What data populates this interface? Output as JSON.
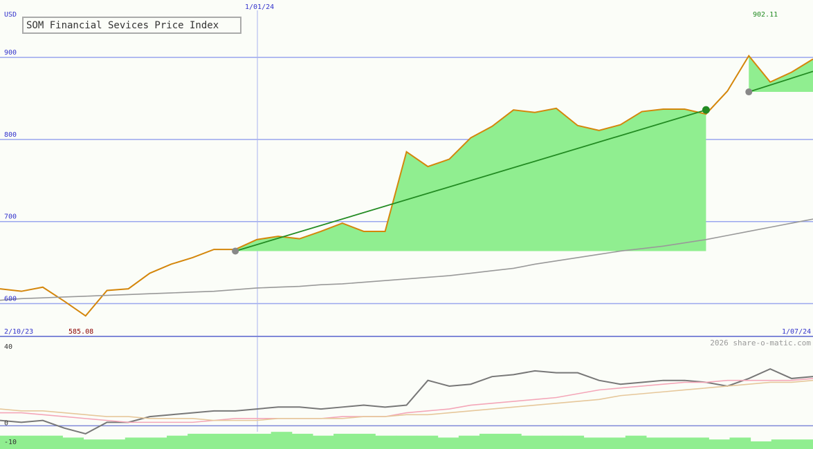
{
  "chart_data": [
    {
      "type": "line",
      "title": "SOM Financial Sevices Price Index",
      "currency_label": "USD",
      "ylim": [
        560,
        970
      ],
      "y_ticks": [
        600,
        700,
        800,
        900
      ],
      "start_date_label": "2/10/23",
      "mid_date_label": "1/01/24",
      "end_date_label": "1/07/24",
      "min_label": "585.08",
      "max_label": "902.11",
      "x": [
        0,
        1,
        2,
        3,
        4,
        5,
        6,
        7,
        8,
        9,
        10,
        11,
        12,
        13,
        14,
        15,
        16,
        17,
        18,
        19,
        20,
        21,
        22,
        23,
        24,
        25,
        26,
        27,
        28,
        29,
        30,
        31,
        32,
        33,
        34,
        35,
        36,
        37,
        38
      ],
      "series": [
        {
          "values": [
            618,
            615,
            620,
            603,
            585,
            616,
            618,
            637,
            648,
            656,
            666,
            666,
            678,
            682,
            679,
            688,
            698,
            688,
            688,
            785,
            767,
            776,
            802,
            816,
            836,
            833,
            838,
            817,
            811,
            818,
            834,
            837,
            837,
            831,
            859,
            902,
            870,
            882,
            898
          ]
        },
        {
          "values": [
            604,
            606,
            607,
            608,
            609,
            610,
            611,
            612,
            613,
            614,
            615,
            617,
            619,
            620,
            621,
            623,
            624,
            626,
            628,
            630,
            632,
            634,
            637,
            640,
            643,
            648,
            652,
            656,
            660,
            664,
            667,
            670,
            674,
            678,
            683,
            688,
            693,
            698,
            703
          ]
        }
      ],
      "trendlines": [
        {
          "from": [
            11,
            664
          ],
          "to": [
            33,
            836
          ]
        },
        {
          "from": [
            35,
            858
          ],
          "to": [
            38,
            883
          ]
        }
      ],
      "marker_color": "#228b22",
      "fill_color": "#90ee90",
      "price_color": "#d4860b",
      "average_color": "#999999"
    },
    {
      "type": "line",
      "copyright": "2026 share-o-matic.com",
      "ylim": [
        -14,
        44
      ],
      "y_ticks": [
        40,
        0,
        -10
      ],
      "tick_labels": [
        "40",
        "0",
        "-10"
      ],
      "x": [
        0,
        1,
        2,
        3,
        4,
        5,
        6,
        7,
        8,
        9,
        10,
        11,
        12,
        13,
        14,
        15,
        16,
        17,
        18,
        19,
        20,
        21,
        22,
        23,
        24,
        25,
        26,
        27,
        28,
        29,
        30,
        31,
        32,
        33,
        34,
        35,
        36,
        37,
        38
      ],
      "series": [
        {
          "values": [
            1,
            0,
            1,
            -3,
            -6,
            0,
            0,
            3,
            4,
            5,
            6,
            6,
            7,
            8,
            8,
            7,
            8,
            9,
            8,
            9,
            22,
            19,
            20,
            24,
            25,
            27,
            26,
            26,
            22,
            20,
            21,
            22,
            22,
            21,
            19,
            23,
            28,
            23,
            24
          ]
        },
        {
          "values": [
            5,
            5,
            4,
            3,
            2,
            1,
            0,
            0,
            0,
            0,
            1,
            2,
            2,
            2,
            2,
            2,
            3,
            3,
            3,
            5,
            6,
            7,
            9,
            10,
            11,
            12,
            13,
            15,
            17,
            18,
            19,
            20,
            21,
            21,
            22,
            22,
            22,
            22,
            23
          ]
        },
        {
          "values": [
            7,
            6,
            6,
            5,
            4,
            3,
            3,
            2,
            2,
            2,
            1,
            1,
            1,
            2,
            2,
            2,
            2,
            3,
            3,
            4,
            4,
            5,
            6,
            7,
            8,
            9,
            10,
            11,
            12,
            14,
            15,
            16,
            17,
            18,
            19,
            20,
            21,
            21,
            22
          ]
        }
      ],
      "colors": [
        "#777777",
        "#f4a6b8",
        "#e6c79a"
      ],
      "histogram": [
        -7,
        -7,
        -7,
        -8,
        -9,
        -9,
        -8,
        -8,
        -7,
        -6,
        -6,
        -6,
        -6,
        -5,
        -6,
        -7,
        -6,
        -6,
        -7,
        -7,
        -7,
        -8,
        -7,
        -6,
        -6,
        -7,
        -7,
        -7,
        -8,
        -8,
        -7,
        -8,
        -8,
        -8,
        -9,
        -8,
        -10,
        -9,
        -9
      ],
      "histogram_color": "#90ee90"
    }
  ]
}
